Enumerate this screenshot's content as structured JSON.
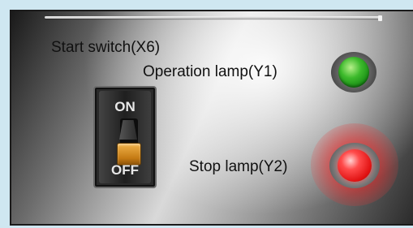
{
  "panel": {
    "labels": {
      "start_switch": "Start switch(X6)",
      "operation_lamp": "Operation lamp(Y1)",
      "stop_lamp": "Stop lamp(Y2)"
    },
    "switch": {
      "on_label": "ON",
      "off_label": "OFF",
      "state": "off"
    },
    "lamps": {
      "operation": {
        "state": "on",
        "color": "#2fae24"
      },
      "stop": {
        "state": "on",
        "color": "#e81414"
      }
    }
  }
}
